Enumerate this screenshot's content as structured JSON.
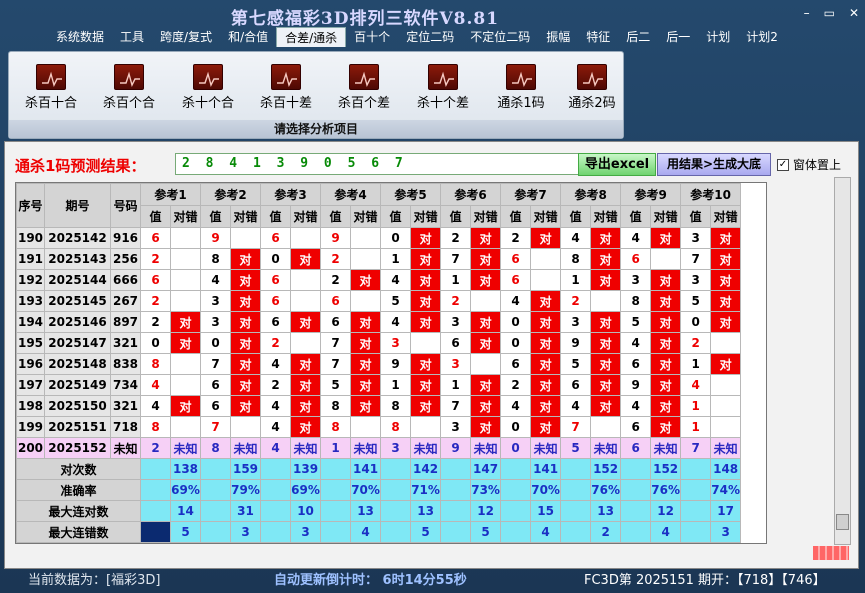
{
  "window": {
    "title": "第七感福彩3D排列三软件V8.81"
  },
  "menu": [
    "系统数据",
    "工具",
    "跨度/复式",
    "和/合值",
    "合差/通杀",
    "百十个",
    "定位二码",
    "不定位二码",
    "振幅",
    "特征",
    "后二",
    "后一",
    "计划",
    "计划2"
  ],
  "active_menu": 4,
  "ribbon": {
    "items": [
      "杀百十合",
      "杀百个合",
      "杀十个合",
      "杀百十差",
      "杀百个差",
      "杀十个差",
      "通杀1码",
      "通杀2码"
    ],
    "caption": "请选择分析项目"
  },
  "prediction": {
    "label": "通杀1码预测结果：",
    "value": "2 8 4 1 3 9 0 5 6 7"
  },
  "buttons": {
    "export": "导出excel",
    "generate": "用结果>生成大底",
    "topmost": "窗体置上"
  },
  "table": {
    "headers": {
      "seq": "序号",
      "period": "期号",
      "number": "号码",
      "value": "值",
      "result": "对错"
    },
    "refs": [
      "参考1",
      "参考2",
      "参考3",
      "参考4",
      "参考5",
      "参考6",
      "参考7",
      "参考8",
      "参考9",
      "参考10"
    ],
    "hit_text": "对",
    "rows": [
      {
        "seq": "190",
        "period": "2025142",
        "num": "916",
        "vals": [
          "6",
          "9",
          "6",
          "9",
          "0",
          "2",
          "2",
          "4",
          "4",
          "3"
        ],
        "hits": [
          0,
          0,
          0,
          0,
          1,
          1,
          1,
          1,
          1,
          1
        ],
        "red": [
          1,
          1,
          1,
          1,
          0,
          0,
          0,
          0,
          0,
          0
        ]
      },
      {
        "seq": "191",
        "period": "2025143",
        "num": "256",
        "vals": [
          "2",
          "8",
          "0",
          "2",
          "1",
          "7",
          "6",
          "8",
          "6",
          "7"
        ],
        "hits": [
          0,
          1,
          1,
          0,
          1,
          1,
          0,
          1,
          0,
          1
        ],
        "red": [
          1,
          0,
          0,
          1,
          0,
          0,
          1,
          0,
          1,
          0
        ]
      },
      {
        "seq": "192",
        "period": "2025144",
        "num": "666",
        "vals": [
          "6",
          "4",
          "6",
          "2",
          "4",
          "1",
          "6",
          "1",
          "3",
          "3"
        ],
        "hits": [
          0,
          1,
          0,
          1,
          1,
          1,
          0,
          1,
          1,
          1
        ],
        "red": [
          1,
          0,
          1,
          0,
          0,
          0,
          1,
          0,
          0,
          0
        ]
      },
      {
        "seq": "193",
        "period": "2025145",
        "num": "267",
        "vals": [
          "2",
          "3",
          "6",
          "6",
          "5",
          "2",
          "4",
          "2",
          "8",
          "5"
        ],
        "hits": [
          0,
          1,
          0,
          0,
          1,
          0,
          1,
          0,
          1,
          1
        ],
        "red": [
          1,
          0,
          1,
          1,
          0,
          1,
          0,
          1,
          0,
          0
        ]
      },
      {
        "seq": "194",
        "period": "2025146",
        "num": "897",
        "vals": [
          "2",
          "3",
          "6",
          "6",
          "4",
          "3",
          "0",
          "3",
          "5",
          "0"
        ],
        "hits": [
          1,
          1,
          1,
          1,
          1,
          1,
          1,
          1,
          1,
          1
        ],
        "red": [
          0,
          0,
          0,
          0,
          0,
          0,
          0,
          0,
          0,
          0
        ]
      },
      {
        "seq": "195",
        "period": "2025147",
        "num": "321",
        "vals": [
          "0",
          "0",
          "2",
          "7",
          "3",
          "6",
          "0",
          "9",
          "4",
          "2"
        ],
        "hits": [
          1,
          1,
          0,
          1,
          0,
          1,
          1,
          1,
          1,
          0
        ],
        "red": [
          0,
          0,
          1,
          0,
          1,
          0,
          0,
          0,
          0,
          1
        ]
      },
      {
        "seq": "196",
        "period": "2025148",
        "num": "838",
        "vals": [
          "8",
          "7",
          "4",
          "7",
          "9",
          "3",
          "6",
          "5",
          "6",
          "1"
        ],
        "hits": [
          0,
          1,
          1,
          1,
          1,
          0,
          1,
          1,
          1,
          1
        ],
        "red": [
          1,
          0,
          0,
          0,
          0,
          1,
          0,
          0,
          0,
          0
        ]
      },
      {
        "seq": "197",
        "period": "2025149",
        "num": "734",
        "vals": [
          "4",
          "6",
          "2",
          "5",
          "1",
          "1",
          "2",
          "6",
          "9",
          "4"
        ],
        "hits": [
          0,
          1,
          1,
          1,
          1,
          1,
          1,
          1,
          1,
          0
        ],
        "red": [
          1,
          0,
          0,
          0,
          0,
          0,
          0,
          0,
          0,
          1
        ]
      },
      {
        "seq": "198",
        "period": "2025150",
        "num": "321",
        "vals": [
          "4",
          "6",
          "4",
          "8",
          "8",
          "7",
          "4",
          "4",
          "4",
          "1"
        ],
        "hits": [
          1,
          1,
          1,
          1,
          1,
          1,
          1,
          1,
          1,
          0
        ],
        "red": [
          0,
          0,
          0,
          0,
          0,
          0,
          0,
          0,
          0,
          1
        ]
      },
      {
        "seq": "199",
        "period": "2025151",
        "num": "718",
        "vals": [
          "8",
          "7",
          "4",
          "8",
          "8",
          "3",
          "0",
          "7",
          "6",
          "1"
        ],
        "hits": [
          0,
          0,
          1,
          0,
          0,
          1,
          1,
          0,
          1,
          0
        ],
        "red": [
          1,
          1,
          0,
          1,
          1,
          0,
          0,
          1,
          0,
          1
        ]
      }
    ],
    "pred_row": {
      "seq": "200",
      "period": "2025152",
      "num": "未知",
      "vals": [
        "2",
        "8",
        "4",
        "1",
        "3",
        "9",
        "0",
        "5",
        "6",
        "7"
      ],
      "result": "未知"
    },
    "stats": [
      {
        "label": "对次数",
        "values": [
          "138",
          "159",
          "139",
          "141",
          "142",
          "147",
          "141",
          "152",
          "152",
          "148"
        ]
      },
      {
        "label": "准确率",
        "values": [
          "69%",
          "79%",
          "69%",
          "70%",
          "71%",
          "73%",
          "70%",
          "76%",
          "76%",
          "74%"
        ]
      },
      {
        "label": "最大连对数",
        "values": [
          "14",
          "31",
          "10",
          "13",
          "13",
          "12",
          "15",
          "13",
          "12",
          "17"
        ]
      },
      {
        "label": "最大连错数",
        "values": [
          "5",
          "3",
          "3",
          "4",
          "5",
          "5",
          "4",
          "2",
          "4",
          "3"
        ]
      }
    ]
  },
  "status": {
    "current": "当前数据为：[福彩3D]",
    "countdown": "自动更新倒计时： 6时14分55秒",
    "latest": "FC3D第 2025151 期开：【718】【746】"
  }
}
